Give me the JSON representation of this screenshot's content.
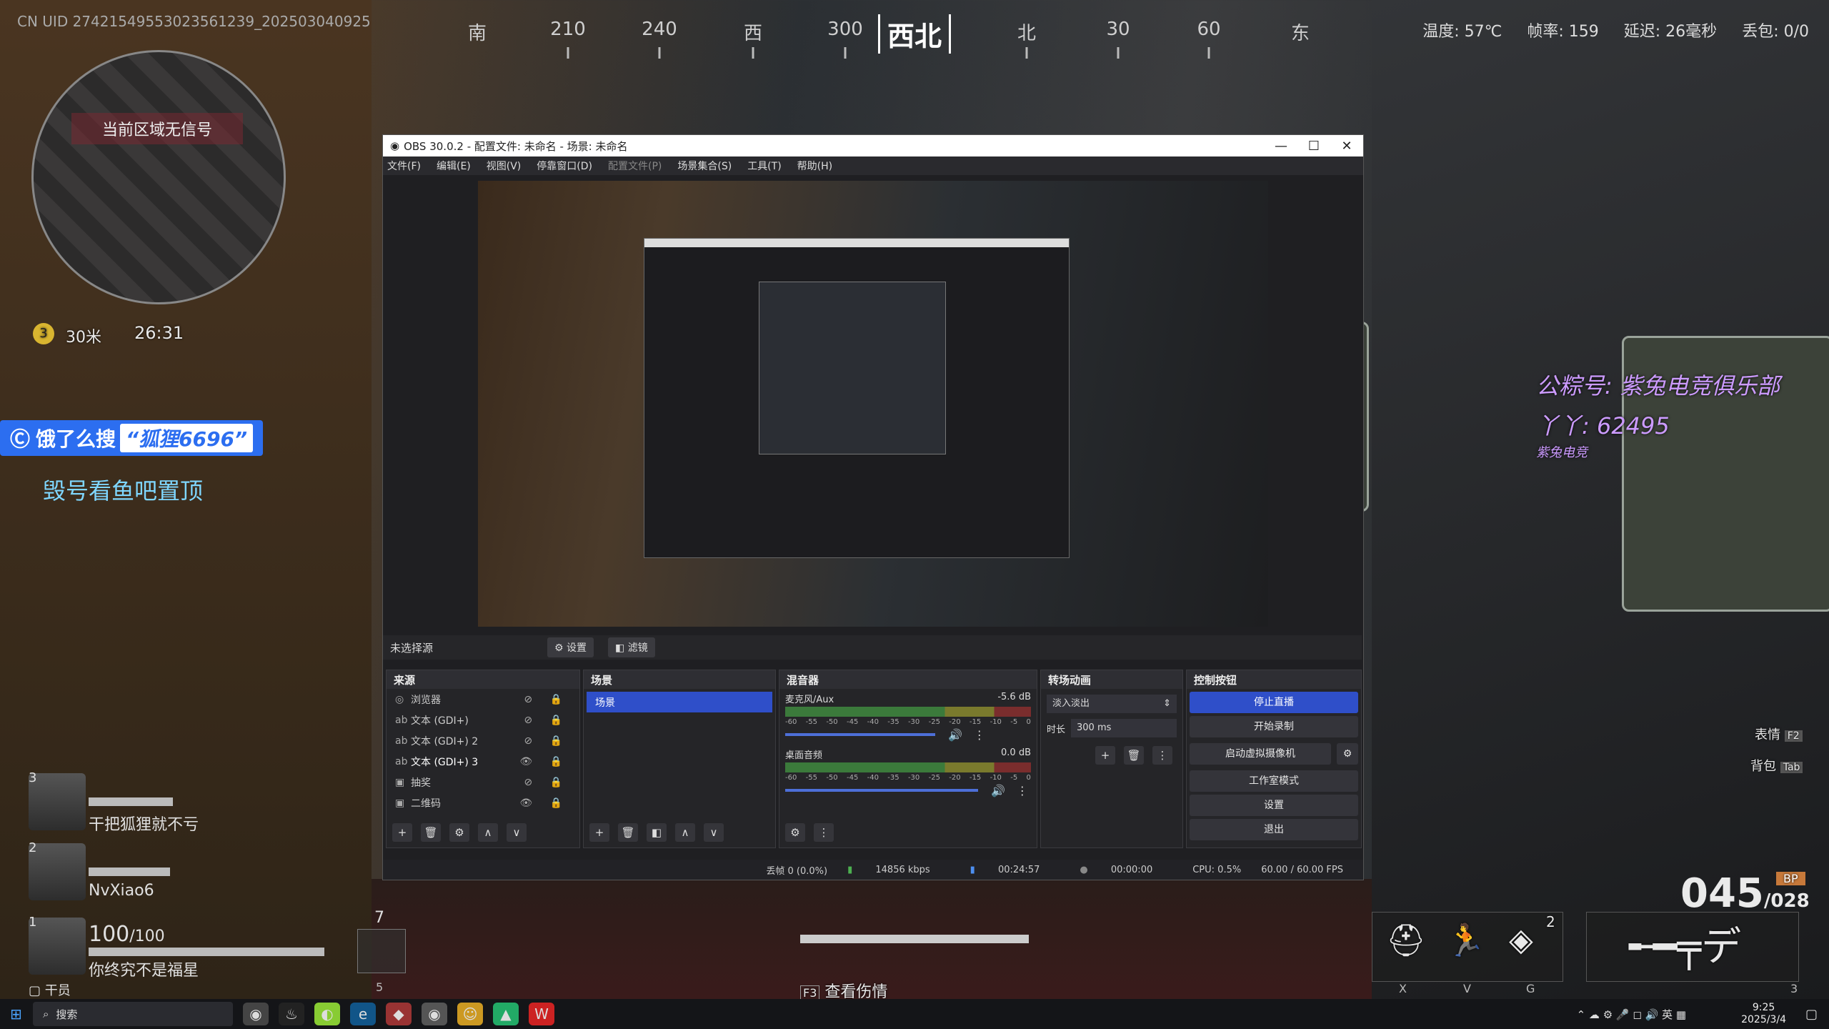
{
  "hud": {
    "cn_uid": "CN UID 27421549553023561239_202503040925",
    "compass": [
      "南",
      "210",
      "240",
      "西",
      "300",
      "北",
      "30",
      "60",
      "东"
    ],
    "compass_current": "西北",
    "stats": [
      "温度: 57℃",
      "帧率: 159",
      "延迟: 26毫秒",
      "丢包: 0/0"
    ],
    "minimap_text": "当前区域无信号",
    "distance": "30米",
    "timer": "26:31",
    "ad_prefix": "饿了么搜",
    "ad_keyword": "“狐狸6696”",
    "pin_text": "毁号看鱼吧置顶",
    "logo_line1": "公粽号: 紫兔电竞俱乐部",
    "logo_line2": "丫丫: 62495",
    "logo_brand": "紫兔电竞",
    "players": [
      {
        "rank": "3",
        "name": "干把狐狸就不亏"
      },
      {
        "rank": "2",
        "name": "NvXiao6"
      },
      {
        "rank": "1",
        "name": "你终究不是福星",
        "hp": "100",
        "hp_max": "/100"
      }
    ],
    "team_label": "干员",
    "slot_count": "7",
    "slot_key": "5",
    "damage_label": "查看伤情",
    "damage_key": "F3",
    "emote_label": "表情",
    "emote_key": "F2",
    "bag_label": "背包",
    "bag_key": "Tab",
    "ammo": "045",
    "ammo_reserve": "/028",
    "ammo_type": "BP",
    "gadget_count": "2",
    "key_x": "X",
    "key_v": "V",
    "key_g": "G",
    "key_3": "3"
  },
  "obs": {
    "title": "OBS 30.0.2 - 配置文件: 未命名 - 场景: 未命名",
    "menu": [
      "文件(F)",
      "编辑(E)",
      "视图(V)",
      "停靠窗口(D)",
      "配置文件(P)",
      "场景集合(S)",
      "工具(T)",
      "帮助(H)"
    ],
    "scene_info": "未选择源",
    "settings_btn": "设置",
    "filter_btn": "滤镜",
    "sources_title": "来源",
    "sources": [
      {
        "icon": "◎",
        "name": "浏览器",
        "eye": "⊘ 🔒"
      },
      {
        "icon": "ab",
        "name": "文本 (GDI+)",
        "eye": "⊘ 🔒"
      },
      {
        "icon": "ab",
        "name": "文本 (GDI+) 2",
        "eye": "⊘ 🔒"
      },
      {
        "icon": "ab",
        "name": "文本 (GDI+) 3",
        "eye": "👁 🔒"
      },
      {
        "icon": "▣",
        "name": "抽奖",
        "eye": "⊘ 🔒"
      },
      {
        "icon": "▣",
        "name": "二维码",
        "eye": "👁 🔒"
      }
    ],
    "scenes_title": "场景",
    "scene_selected": "场景",
    "mixer_title": "混音器",
    "mic_name": "麦克风/Aux",
    "mic_db": "-5.6 dB",
    "desktop_name": "桌面音频",
    "desktop_db": "0.0 dB",
    "scale_ticks": [
      "-60",
      "-55",
      "-50",
      "-45",
      "-40",
      "-35",
      "-30",
      "-25",
      "-20",
      "-15",
      "-10",
      "-5",
      "0"
    ],
    "transition_title": "转场动画",
    "transition_value": "淡入淡出",
    "duration_label": "时长",
    "duration_value": "300 ms",
    "controls_title": "控制按钮",
    "controls": [
      "停止直播",
      "开始录制",
      "启动虚拟摄像机",
      "工作室模式",
      "设置",
      "退出"
    ],
    "status": [
      "丢帧 0 (0.0%)",
      "14856 kbps",
      "00:24:57",
      "00:00:00",
      "CPU: 0.5%",
      "60.00 / 60.00 FPS"
    ]
  },
  "taskbar": {
    "search_label": "搜索",
    "time": "9:25",
    "date": "2025/3/4",
    "lang": "英"
  },
  "colors": {
    "accent": "#2c6ef0",
    "obs_selected": "#2f4fc9",
    "pin": "#7fd7ff",
    "logo": "#cc9bff"
  }
}
